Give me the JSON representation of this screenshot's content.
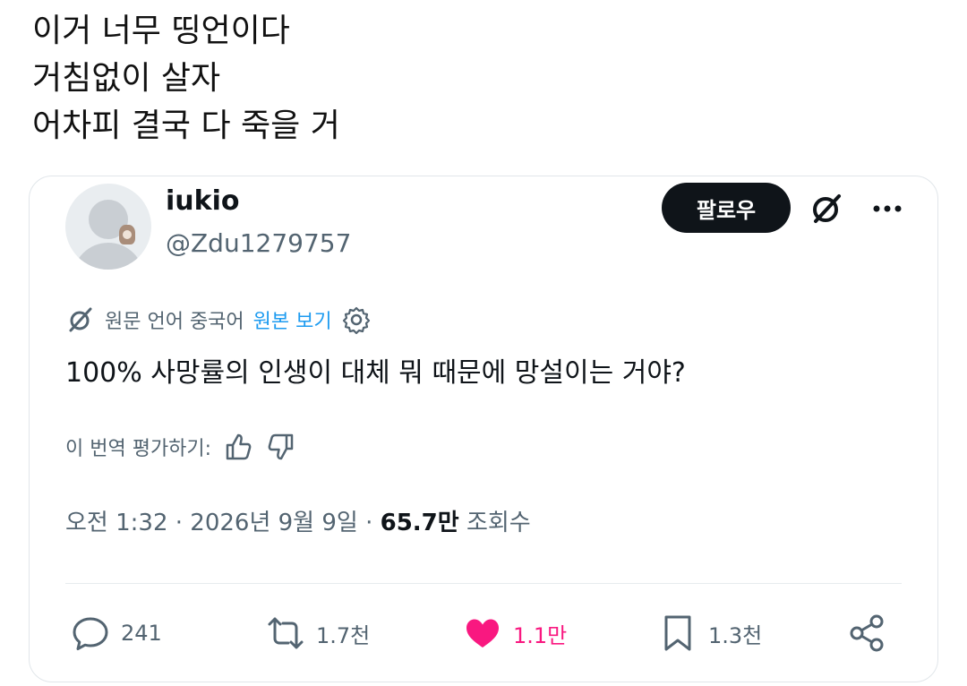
{
  "caption": [
    "이거 너무 띵언이다",
    "거침없이 살자",
    "어차피 결국 다 죽을 거"
  ],
  "tweet": {
    "author_name": "iukio",
    "author_handle": "@Zdu1279757",
    "follow_label": "팔로우",
    "translation": {
      "source_text": "원문 언어 중국어",
      "show_original_label": "원본 보기"
    },
    "text": "100% 사망률의 인생이 대체 뭐 때문에 망설이는 거야?",
    "rate_label": "이 번역 평가하기:",
    "time": "오전 1:32 · 2026년 9월 9일 · ",
    "views_count": "65.7만",
    "views_label": " 조회수",
    "actions": {
      "replies": "241",
      "reposts": "1.7천",
      "likes": "1.1만",
      "bookmarks": "1.3천"
    }
  },
  "colors": {
    "accent": "#1d9bf0",
    "like": "#f91880",
    "muted": "#536471",
    "text": "#0f1419"
  },
  "icons": [
    "grok-icon",
    "more-icon",
    "settings-icon",
    "thumbs-up-icon",
    "thumbs-down-icon",
    "reply-icon",
    "repost-icon",
    "heart-icon",
    "bookmark-icon",
    "share-icon"
  ]
}
